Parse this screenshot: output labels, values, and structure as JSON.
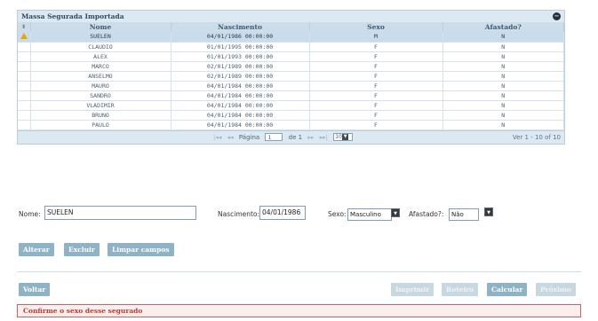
{
  "grid": {
    "caption": "Massa Segurada Importada",
    "columns": [
      "Nome",
      "Nascimento",
      "Sexo",
      "Afastado?"
    ],
    "rows": [
      {
        "nome": "SUELEN",
        "nascimento": "04/01/1986 00:00:00",
        "sexo": "M",
        "afastado": "N",
        "warning": true
      },
      {
        "nome": "CLAUDIO",
        "nascimento": "01/01/1995 00:00:00",
        "sexo": "F",
        "afastado": "N"
      },
      {
        "nome": "ALEX",
        "nascimento": "01/01/1993 00:00:00",
        "sexo": "F",
        "afastado": "N"
      },
      {
        "nome": "MARCO",
        "nascimento": "02/01/1989 00:00:00",
        "sexo": "F",
        "afastado": "N"
      },
      {
        "nome": "ANSELMO",
        "nascimento": "02/01/1989 00:00:00",
        "sexo": "F",
        "afastado": "N"
      },
      {
        "nome": "MAURO",
        "nascimento": "04/01/1984 00:00:00",
        "sexo": "F",
        "afastado": "N"
      },
      {
        "nome": "SANDRO",
        "nascimento": "04/01/1984 00:00:00",
        "sexo": "F",
        "afastado": "N"
      },
      {
        "nome": "VLADIMIR",
        "nascimento": "04/01/1984 00:00:00",
        "sexo": "F",
        "afastado": "N"
      },
      {
        "nome": "BRUNO",
        "nascimento": "04/01/1984 00:00:00",
        "sexo": "F",
        "afastado": "N"
      },
      {
        "nome": "PAULO",
        "nascimento": "04/01/1984 00:00:00",
        "sexo": "F",
        "afastado": "N"
      }
    ],
    "pager": {
      "first_glyph": "|◂◂",
      "prev_glyph": "◂◂",
      "page_label": "Página",
      "page_value": "1",
      "of_label": "de 1",
      "next_glyph": "▸▸",
      "last_glyph": "▸▸|",
      "rows_per_page": "10",
      "info": "Ver 1 - 10 of 10"
    }
  },
  "form": {
    "nome_label": "Nome:",
    "nome_value": "SUELEN",
    "nascimento_label": "Nascimento:",
    "nascimento_value": "04/01/1986",
    "sexo_label": "Sexo:",
    "sexo_value": "Masculino",
    "afastado_label": "Afastado?:",
    "afastado_value": "Não"
  },
  "actions": {
    "alterar": "Alterar",
    "excluir": "Excluir",
    "limpar": "Limpar campos"
  },
  "footer": {
    "voltar": "Voltar",
    "imprimir": "Imprimir",
    "roteiro": "Roteiro",
    "calcular": "Calcular",
    "proximo": "Próximo"
  },
  "error_message": "Confirme o sexo desse segurado",
  "colors": {
    "accent": "#8fb3c6",
    "error": "#c0392b",
    "warning": "#e9a600"
  }
}
